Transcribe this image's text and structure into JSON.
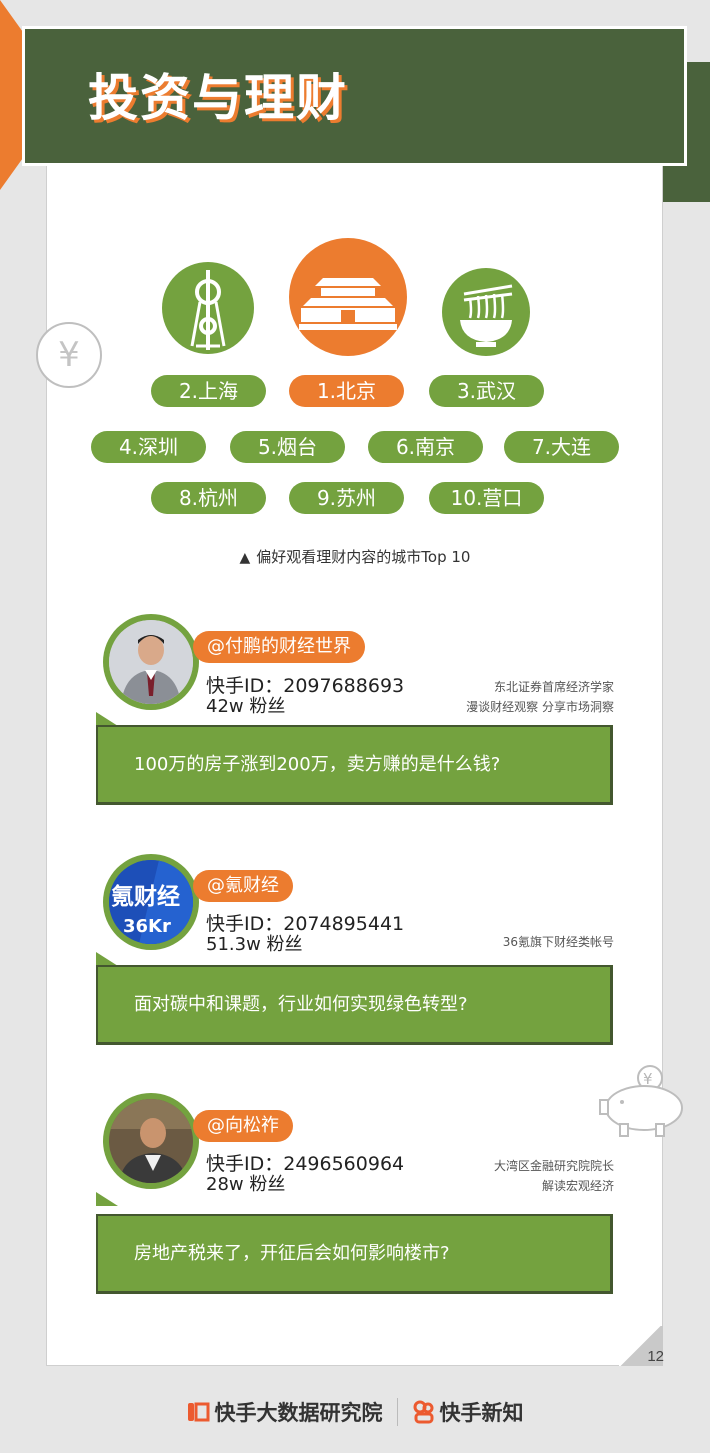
{
  "header": {
    "title": "投资与理财"
  },
  "cities": {
    "top3": [
      {
        "label": "2.上海",
        "icon": "tower-icon",
        "color": "#74a23f"
      },
      {
        "label": "1.北京",
        "icon": "tiananmen-icon",
        "color": "#ec7c2f"
      },
      {
        "label": "3.武汉",
        "icon": "noodle-bowl-icon",
        "color": "#74a23f"
      }
    ],
    "row2": [
      "4.深圳",
      "5.烟台",
      "6.南京",
      "7.大连"
    ],
    "row3": [
      "8.杭州",
      "9.苏州",
      "10.营口"
    ],
    "caption": "偏好观看理财内容的城市Top 10",
    "caption_marker": "▲"
  },
  "creators": [
    {
      "handle": "@付鹏的财经世界",
      "kid": "快手ID：2097688693",
      "fans": "42w 粉丝",
      "desc_line1": "东北证券首席经济学家",
      "desc_line2": "漫谈财经观察 分享市场洞察",
      "topic": "100万的房子涨到200万，卖方赚的是什么钱?"
    },
    {
      "handle": "@氪财经",
      "kid": "快手ID：2074895441",
      "fans": "51.3w 粉丝",
      "avatar_text": "氪财经",
      "avatar_sub": "36Kr",
      "desc_line1": "36氪旗下财经类帐号",
      "desc_line2": "",
      "topic": "面对碳中和课题，行业如何实现绿色转型?"
    },
    {
      "handle": "@向松祚",
      "kid": "快手ID：2496560964",
      "fans": "28w 粉丝",
      "desc_line1": "大湾区金融研究院院长",
      "desc_line2": "解读宏观经济",
      "topic": "房地产税来了，开征后会如何影响楼市?"
    }
  ],
  "decor": {
    "yen_symbol": "¥"
  },
  "page_number": "12",
  "footer": {
    "brand1": "快手大数据研究院",
    "brand2": "快手新知"
  },
  "colors": {
    "dark_green": "#4a623c",
    "green": "#74a23f",
    "orange": "#ec7c2f"
  }
}
